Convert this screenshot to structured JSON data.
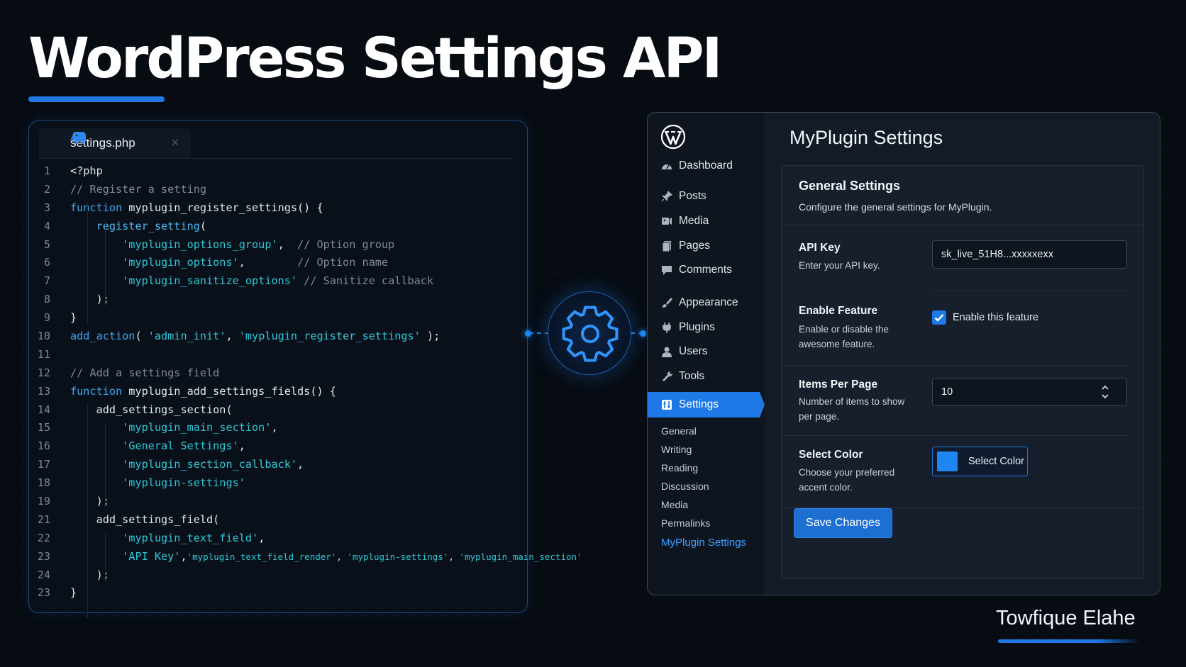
{
  "title": "WordPress Settings API",
  "editor": {
    "tab_label": "settings.php",
    "lines": [
      {
        "num": "1",
        "tokens": [
          {
            "t": "<?php",
            "c": "plain"
          }
        ]
      },
      {
        "num": "2",
        "tokens": [
          {
            "t": "// Register a setting",
            "c": "com"
          }
        ]
      },
      {
        "num": "3",
        "tokens": [
          {
            "t": "function",
            "c": "kw"
          },
          {
            "t": " myplugin_register_settings() {",
            "c": "plain"
          }
        ]
      },
      {
        "num": "4",
        "tokens": [
          {
            "t": "    ",
            "c": "plain"
          },
          {
            "t": "register_setting",
            "c": "fn"
          },
          {
            "t": "(",
            "c": "plain"
          }
        ]
      },
      {
        "num": "5",
        "tokens": [
          {
            "t": "        ",
            "c": "plain"
          },
          {
            "t": "'myplugin_options_group'",
            "c": "str"
          },
          {
            "t": ",  ",
            "c": "plain"
          },
          {
            "t": "// Option group",
            "c": "com"
          }
        ]
      },
      {
        "num": "6",
        "tokens": [
          {
            "t": "        ",
            "c": "plain"
          },
          {
            "t": "'myplugin_options'",
            "c": "str"
          },
          {
            "t": ",        ",
            "c": "plain"
          },
          {
            "t": "// Option name",
            "c": "com"
          }
        ]
      },
      {
        "num": "7",
        "tokens": [
          {
            "t": "        ",
            "c": "plain"
          },
          {
            "t": "'myplugin_sanitize_options'",
            "c": "str"
          },
          {
            "t": " ",
            "c": "plain"
          },
          {
            "t": "// Sanitize callback",
            "c": "com"
          }
        ]
      },
      {
        "num": "8",
        "tokens": [
          {
            "t": "    );",
            "c": "plain"
          }
        ]
      },
      {
        "num": "9",
        "tokens": [
          {
            "t": "}",
            "c": "plain"
          }
        ]
      },
      {
        "num": "10",
        "tokens": [
          {
            "t": "add_action",
            "c": "kw"
          },
          {
            "t": "( ",
            "c": "plain"
          },
          {
            "t": "'admin_init'",
            "c": "str"
          },
          {
            "t": ", ",
            "c": "plain"
          },
          {
            "t": "'myplugin_register_settings'",
            "c": "str"
          },
          {
            "t": " );",
            "c": "plain"
          }
        ]
      },
      {
        "num": "11",
        "tokens": []
      },
      {
        "num": "12",
        "tokens": [
          {
            "t": "// Add a settings field",
            "c": "com"
          }
        ]
      },
      {
        "num": "13",
        "tokens": [
          {
            "t": "function",
            "c": "kw"
          },
          {
            "t": " myplugin_add_settings_fields() {",
            "c": "plain"
          }
        ]
      },
      {
        "num": "14",
        "tokens": [
          {
            "t": "    add_settings_section(",
            "c": "plain"
          }
        ]
      },
      {
        "num": "15",
        "tokens": [
          {
            "t": "        ",
            "c": "plain"
          },
          {
            "t": "'myplugin_main_section'",
            "c": "str"
          },
          {
            "t": ",",
            "c": "plain"
          }
        ]
      },
      {
        "num": "16",
        "tokens": [
          {
            "t": "        ",
            "c": "plain"
          },
          {
            "t": "'General Settings'",
            "c": "str"
          },
          {
            "t": ",",
            "c": "plain"
          }
        ]
      },
      {
        "num": "17",
        "tokens": [
          {
            "t": "        ",
            "c": "plain"
          },
          {
            "t": "'myplugin_section_callback'",
            "c": "str"
          },
          {
            "t": ",",
            "c": "plain"
          }
        ]
      },
      {
        "num": "18",
        "tokens": [
          {
            "t": "        ",
            "c": "plain"
          },
          {
            "t": "'myplugin-settings'",
            "c": "str"
          }
        ]
      },
      {
        "num": "19",
        "tokens": [
          {
            "t": "    );",
            "c": "plain"
          }
        ]
      },
      {
        "num": "21",
        "tokens": [
          {
            "t": "    add_settings_field(",
            "c": "plain"
          }
        ]
      },
      {
        "num": "22",
        "tokens": [
          {
            "t": "        ",
            "c": "plain"
          },
          {
            "t": "'myplugin_text_field'",
            "c": "str"
          },
          {
            "t": ",",
            "c": "plain"
          }
        ]
      },
      {
        "num": "23",
        "tokens": [
          {
            "t": "        ",
            "c": "plain"
          },
          {
            "t": "'API Key'",
            "c": "str"
          },
          {
            "t": ",",
            "c": "plain"
          },
          {
            "t": "'myplugin_text_field_render'",
            "c": "str small"
          },
          {
            "t": ", ",
            "c": "plain small"
          },
          {
            "t": "'myplugin-settings'",
            "c": "str small"
          },
          {
            "t": ", ",
            "c": "plain small"
          },
          {
            "t": "'myplugin_main_section'",
            "c": "str small"
          }
        ]
      },
      {
        "num": "24",
        "tokens": [
          {
            "t": "    );",
            "c": "plain"
          }
        ]
      },
      {
        "num": "23",
        "tokens": [
          {
            "t": "}",
            "c": "plain"
          }
        ]
      }
    ]
  },
  "admin": {
    "menu": [
      {
        "label": "Dashboard",
        "icon": "dashboard-icon"
      },
      {
        "label": "Posts",
        "icon": "pin-icon"
      },
      {
        "label": "Media",
        "icon": "media-icon"
      },
      {
        "label": "Pages",
        "icon": "pages-icon"
      },
      {
        "label": "Comments",
        "icon": "comment-icon"
      },
      {
        "label": "Appearance",
        "icon": "brush-icon"
      },
      {
        "label": "Plugins",
        "icon": "plug-icon"
      },
      {
        "label": "Users",
        "icon": "user-icon"
      },
      {
        "label": "Tools",
        "icon": "wrench-icon"
      },
      {
        "label": "Settings",
        "icon": "settings-icon"
      }
    ],
    "submenu": [
      "General",
      "Writing",
      "Reading",
      "Discussion",
      "Media",
      "Permalinks",
      "MyPlugin Settings"
    ],
    "page_title": "MyPlugin Settings",
    "section": {
      "title": "General Settings",
      "description": "Configure the general settings for MyPlugin."
    },
    "api_key": {
      "label": "API Key",
      "help": "Enter your API key.",
      "value": "sk_live_51H8...xxxxxexx"
    },
    "enable_feature": {
      "label": "Enable Feature",
      "help": "Enable or disable the awesome feature.",
      "checkbox_label": "Enable this feature",
      "checked": true
    },
    "items_per_page": {
      "label": "Items Per Page",
      "help": "Number of items to show per page.",
      "value": "10"
    },
    "select_color": {
      "label": "Select Color",
      "help": "Choose your preferred accent color.",
      "button_label": "Select Color",
      "swatch_color": "#1e86f0"
    },
    "save_label": "Save Changes"
  },
  "author": "Towfique Elahe",
  "colors": {
    "accent": "#1e78e6",
    "background": "#070b12"
  }
}
